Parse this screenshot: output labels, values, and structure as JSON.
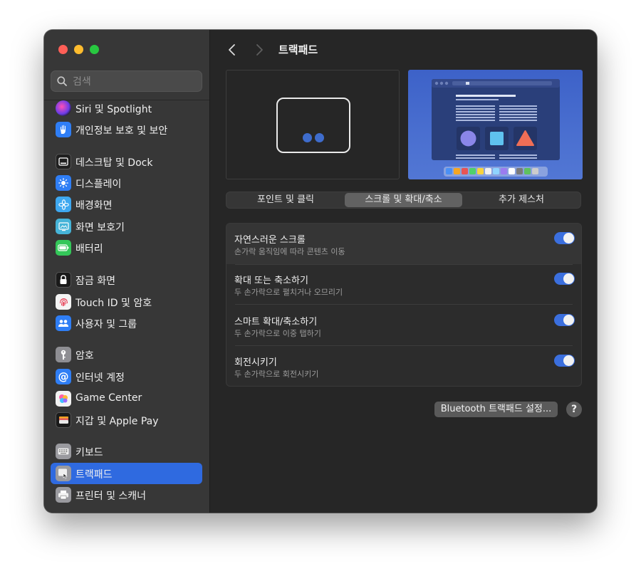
{
  "window": {
    "title": "트랙패드"
  },
  "colors": {
    "accent": "#2f6ae0",
    "toggle_on": "#3b6fde",
    "close": "#ff5f57",
    "minimize": "#febc2e",
    "zoom": "#28c840"
  },
  "search": {
    "placeholder": "검색",
    "value": ""
  },
  "sidebar": {
    "items": [
      {
        "label": "Siri 및 Spotlight",
        "icon": "siri-icon"
      },
      {
        "label": "개인정보 보호 및 보안",
        "icon": "hand-icon"
      },
      {
        "label": "데스크탑 및 Dock",
        "icon": "dock-icon"
      },
      {
        "label": "디스플레이",
        "icon": "sun-icon"
      },
      {
        "label": "배경화면",
        "icon": "flower-icon"
      },
      {
        "label": "화면 보호기",
        "icon": "screensaver-icon"
      },
      {
        "label": "배터리",
        "icon": "battery-icon"
      },
      {
        "label": "잠금 화면",
        "icon": "lock-icon"
      },
      {
        "label": "Touch ID 및 암호",
        "icon": "fingerprint-icon"
      },
      {
        "label": "사용자 및 그룹",
        "icon": "users-icon"
      },
      {
        "label": "암호",
        "icon": "key-icon"
      },
      {
        "label": "인터넷 계정",
        "icon": "at-icon"
      },
      {
        "label": "Game Center",
        "icon": "game-center-icon"
      },
      {
        "label": "지갑 및 Apple Pay",
        "icon": "wallet-icon"
      },
      {
        "label": "키보드",
        "icon": "keyboard-icon"
      },
      {
        "label": "트랙패드",
        "icon": "trackpad-icon",
        "selected": true
      },
      {
        "label": "프린터 및 스캐너",
        "icon": "printer-icon"
      }
    ]
  },
  "tabs": [
    {
      "label": "포인트 및 클릭",
      "selected": false
    },
    {
      "label": "스크롤 및 확대/축소",
      "selected": true
    },
    {
      "label": "추가 제스처",
      "selected": false
    }
  ],
  "settings": [
    {
      "title": "자연스러운 스크롤",
      "subtitle": "손가락 움직임에 따라 콘텐츠 이동",
      "enabled": true
    },
    {
      "title": "확대 또는 축소하기",
      "subtitle": "두 손가락으로 펼치거나 오므리기",
      "enabled": true
    },
    {
      "title": "스마트 확대/축소하기",
      "subtitle": "두 손가락으로 이중 탭하기",
      "enabled": true
    },
    {
      "title": "회전시키기",
      "subtitle": "두 손가락으로 회전시키기",
      "enabled": true
    }
  ],
  "footer": {
    "bluetooth_label": "Bluetooth 트랙패드 설정...",
    "help_label": "?"
  }
}
